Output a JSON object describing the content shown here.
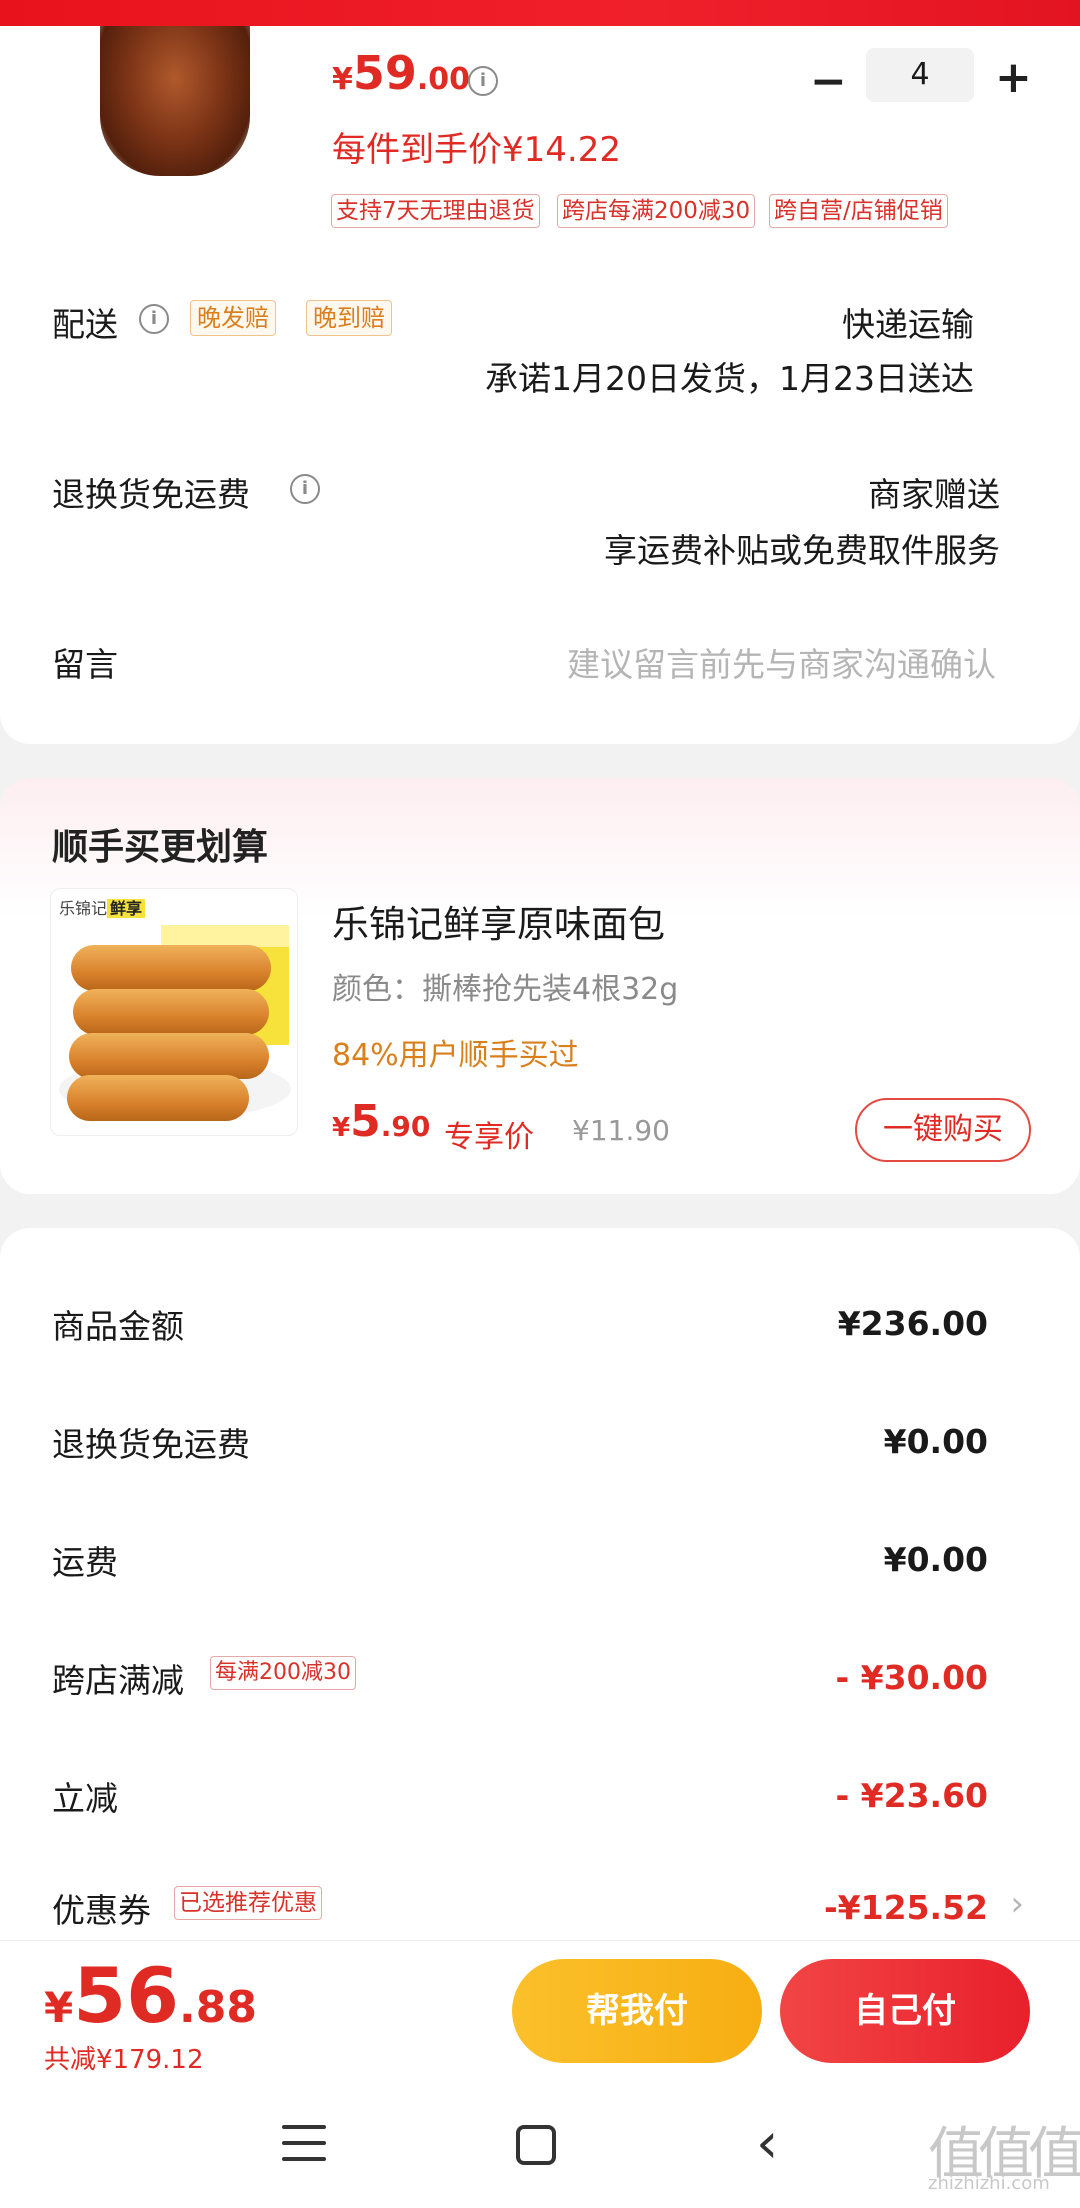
{
  "product": {
    "price_symbol": "¥",
    "price_int": "59",
    "price_dec": ".00",
    "unit_price": "每件到手价¥14.22",
    "quantity": "4",
    "tags": [
      "支持7天无理由退货",
      "跨店每满200减30",
      "跨自营/店铺促销"
    ]
  },
  "delivery": {
    "label": "配送",
    "tags": [
      "晚发赔",
      "晚到赔"
    ],
    "method": "快递运输",
    "promise": "承诺1月20日发货，1月23日送达"
  },
  "return_shipping": {
    "label": "退换货免运费",
    "value": "商家赠送",
    "detail": "享运费补贴或免费取件服务"
  },
  "message": {
    "label": "留言",
    "placeholder": "建议留言前先与商家沟通确认"
  },
  "upsell": {
    "title": "顺手买更划算",
    "image_brand": "乐锦记",
    "image_sub": "鲜享",
    "name": "乐锦记鲜享原味面包",
    "spec": "颜色：撕棒抢先装4根32g",
    "stat": "84%用户顺手买过",
    "price_symbol": "¥",
    "price_int": "5",
    "price_dec": ".90",
    "exclusive_label": "专享价",
    "original_price": "¥11.90",
    "buy_button": "一键购买"
  },
  "summary": {
    "rows": [
      {
        "label": "商品金额",
        "value": "¥236.00"
      },
      {
        "label": "退换货免运费",
        "value": "¥0.00"
      },
      {
        "label": "运费",
        "value": "¥0.00"
      },
      {
        "label": "跨店满减",
        "tag": "每满200减30",
        "value": "- ¥30.00"
      },
      {
        "label": "立减",
        "value": "- ¥23.60"
      },
      {
        "label": "优惠券",
        "tag": "已选推荐优惠",
        "value": "-¥125.52"
      }
    ]
  },
  "checkout": {
    "total_symbol": "¥",
    "total_int": "56",
    "total_dec": ".88",
    "total_saved": "共减¥179.12",
    "help_pay": "帮我付",
    "self_pay": "自己付"
  },
  "watermark": {
    "logo": "值值值",
    "url": "zhizhizhi.com"
  },
  "colors": {
    "accent_red": "#e02b24",
    "orange": "#d9801d",
    "help_button": "#fbc02b",
    "self_button": "#e8202c"
  }
}
